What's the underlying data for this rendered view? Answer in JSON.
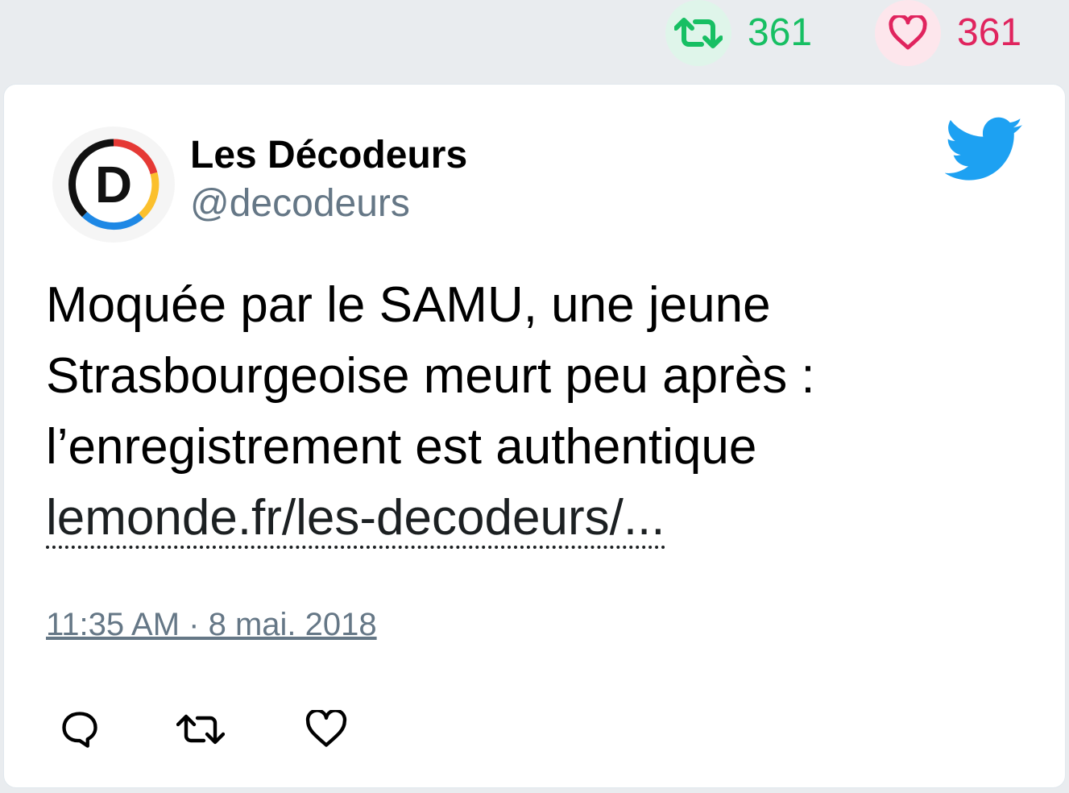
{
  "top_stats": {
    "retweet_count": "361",
    "like_count": "361"
  },
  "tweet": {
    "author_name": "Les Décodeurs",
    "author_handle": "@decodeurs",
    "avatar_letter": "D",
    "text_lines": [
      "Moquée par le SAMU, une jeune",
      "Strasbourgeoise meurt peu après :",
      "l’enregistrement est authentique"
    ],
    "link_text": "lemonde.fr/les-decodeurs/...",
    "timestamp": "11:35 AM · 8 mai. 2018"
  },
  "icons": {
    "retweet": "retweet-icon",
    "like": "heart-icon",
    "reply": "reply-icon",
    "brand": "twitter-bird-icon"
  },
  "colors": {
    "retweet_green": "#17bf63",
    "like_red": "#e0245e",
    "twitter_blue": "#1da1f2",
    "secondary_gray": "#657786"
  }
}
